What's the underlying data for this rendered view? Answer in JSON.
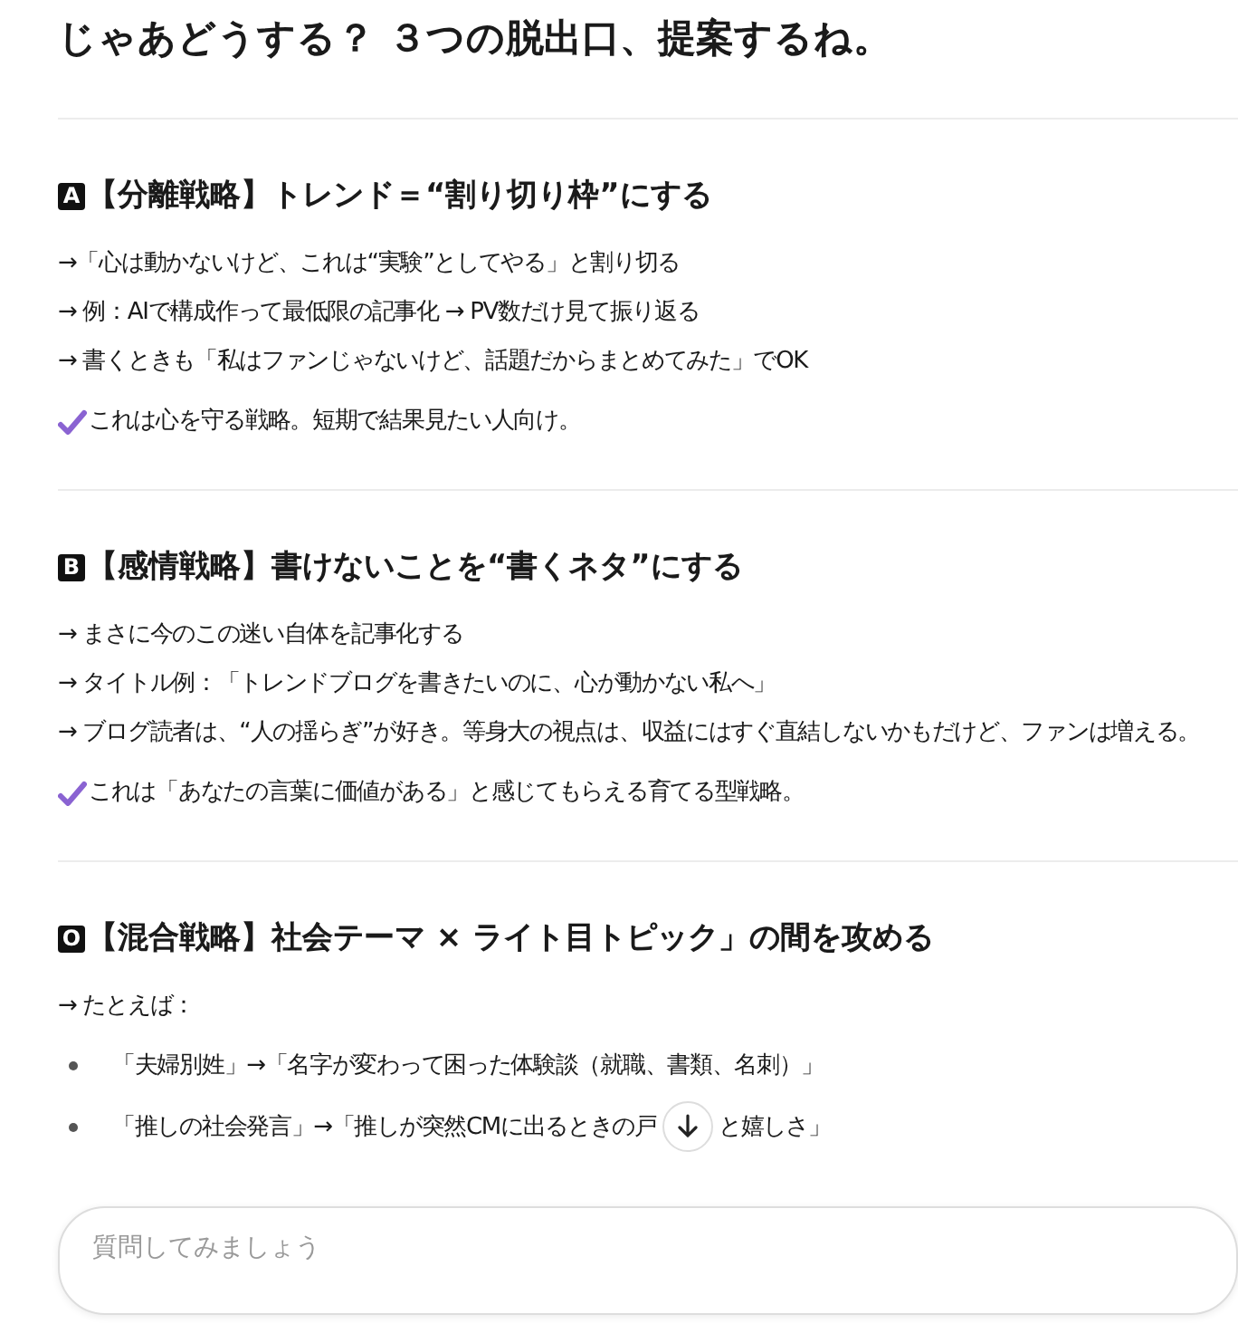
{
  "title": "じゃあどうする？ ３つの脱出口、提案するね。",
  "sections": [
    {
      "badge": "A",
      "heading": "【分離戦略】トレンド＝“割り切り枠”にする",
      "items": [
        {
          "kind": "line",
          "segments": [
            "→「心は動かないけど、これは“実験”としてやる」と割り切る"
          ]
        },
        {
          "kind": "line",
          "segments": [
            "→ 例：AIで構成作って最低限の記事化 → PV数だけ見て振り返る"
          ]
        },
        {
          "kind": "line",
          "segments": [
            "→ 書くときも「私はファンじゃないけど、話題だからまとめてみた」でOK"
          ]
        },
        {
          "kind": "check",
          "segments": [
            "これは心を守る戦略。短期で結果見たい人向け。"
          ]
        }
      ]
    },
    {
      "badge": "B",
      "heading": "【感情戦略】書けないことを“書くネタ”にする",
      "items": [
        {
          "kind": "line",
          "segments": [
            "→ まさに今のこの迷い自体を記事化する"
          ]
        },
        {
          "kind": "line",
          "segments": [
            "→ タイトル例：「トレンドブログを書きたいのに、心が動かない私へ」"
          ]
        },
        {
          "kind": "line",
          "segments": [
            "→ ブログ読者は、“人の揺らぎ”が好き。等身大の視点は、収益にはすぐ直結しないかもだけど、ファンは増える。"
          ]
        },
        {
          "kind": "check",
          "segments": [
            "これは「あなたの言葉に価値がある」と感じてもらえる育てる型戦略。"
          ]
        }
      ]
    },
    {
      "badge": "O",
      "heading": "【混合戦略】社会テーマ × ライト目トピック」の間を攻める",
      "items": [
        {
          "kind": "line",
          "segments": [
            "→ たとえば："
          ]
        },
        {
          "kind": "bullet",
          "segments": [
            "「夫婦別姓」→「名字が変わって困った体験談（就職、書類、名刺）」"
          ]
        },
        {
          "kind": "bullet",
          "segments": [
            "「推しの社会発言」→「推しが突然CMに出るときの戸",
            "と嬉しさ」"
          ]
        }
      ]
    }
  ],
  "composer": {
    "placeholder": "質問してみましょう"
  }
}
